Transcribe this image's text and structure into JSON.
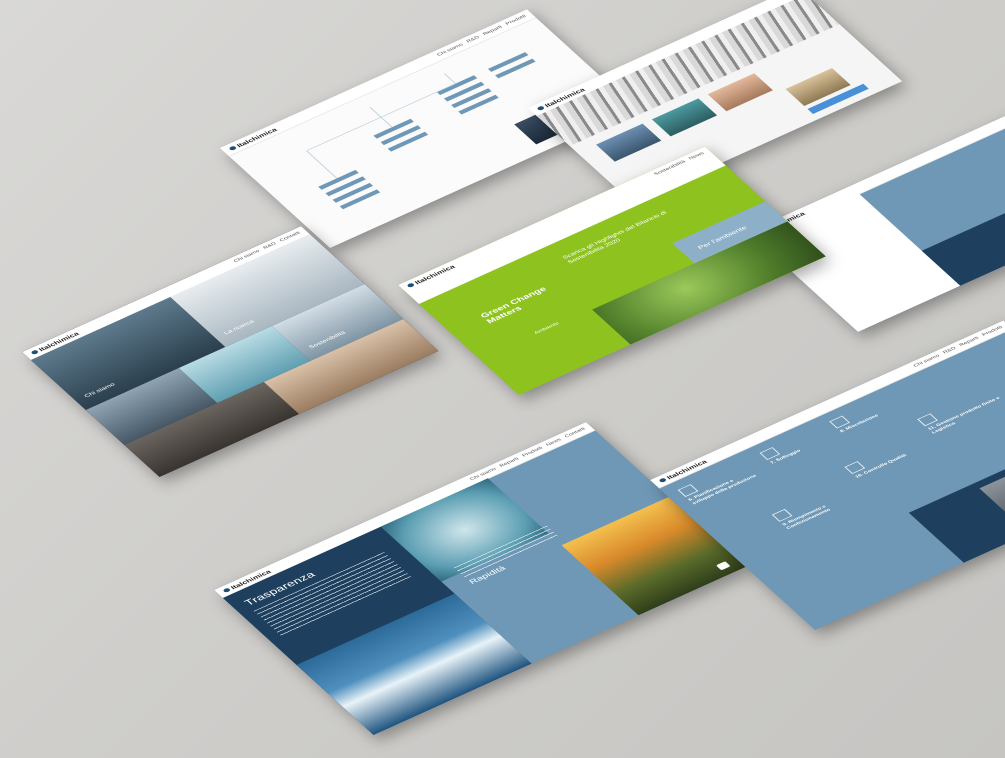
{
  "brand": "Italchimica",
  "nav_links": [
    "Chi siamo",
    "R&D",
    "Reparti",
    "Prodotti",
    "Sostenibilità",
    "News",
    "Contatti"
  ],
  "cards": {
    "trasparenza": {
      "title": "Trasparenza"
    },
    "rapidita": {
      "title": "Rapidità"
    },
    "green": {
      "logo_text": "Green Change Matters",
      "headline": "Scarica gli Highlights del Bilancio di Sostenibilità 2020",
      "ambiente_label": "Ambiente",
      "ambiente_title": "Per l'ambiente"
    },
    "process": {
      "steps": [
        "6. Pianificazione e sviluppo della produzione",
        "7. Softeggio",
        "8. Miscelazione",
        "9. Riempimento e Confezionamento",
        "10. Controllo Qualità",
        "11. Gestione prodotto finito e Logistica"
      ]
    },
    "photo_grid": {
      "labels": [
        "Chi siamo",
        "La ricerca",
        "Sostenibilità"
      ]
    }
  },
  "colors": {
    "navy": "#1e3f5e",
    "steel": "#6f98b6",
    "light_steel": "#8db0c8",
    "green": "#8dc21f",
    "white": "#ffffff"
  }
}
